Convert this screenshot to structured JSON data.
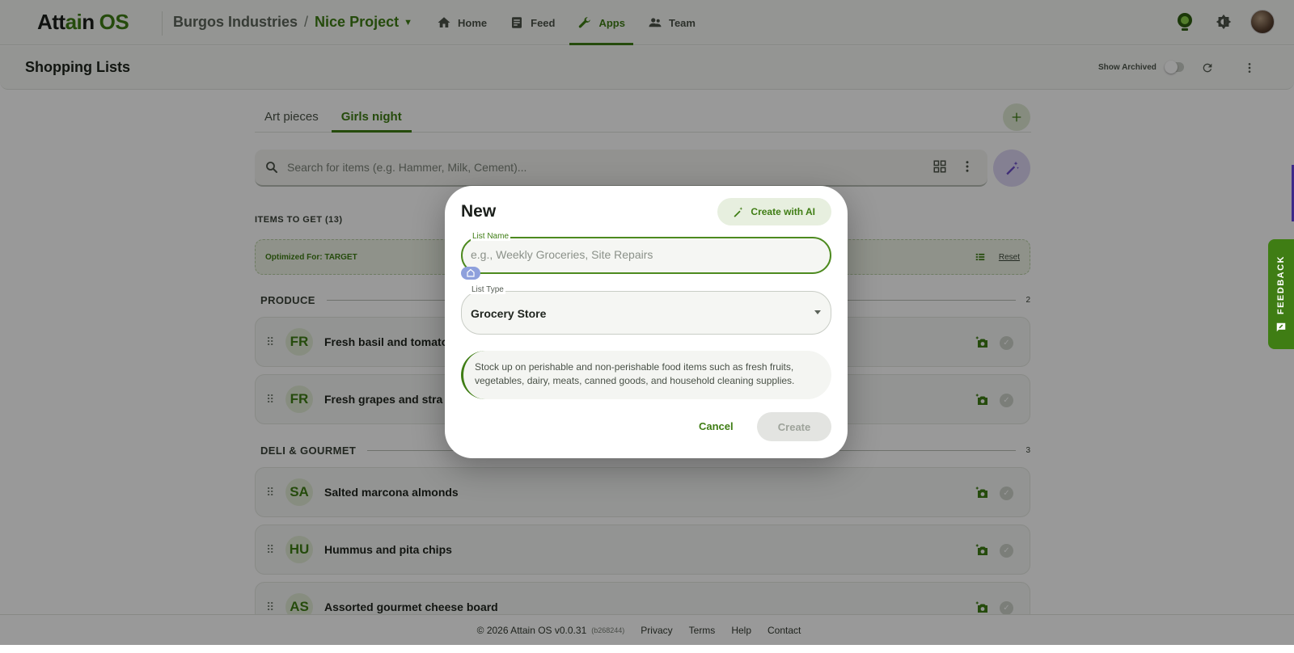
{
  "app": {
    "logo_part1": "Att",
    "logo_part2": "ai",
    "logo_part3": "n",
    "logo_os": "OS",
    "org_name": "Burgos Industries",
    "separator": "/",
    "project_name": "Nice Project",
    "nav": [
      {
        "label": "Home",
        "icon": "home-icon"
      },
      {
        "label": "Feed",
        "icon": "feed-icon"
      },
      {
        "label": "Apps",
        "icon": "wrench-icon",
        "active": true
      },
      {
        "label": "Team",
        "icon": "team-icon"
      }
    ]
  },
  "subheader": {
    "title": "Shopping Lists",
    "show_archived_label": "Show Archived",
    "show_archived_on": false
  },
  "tabs": [
    {
      "label": "Art pieces"
    },
    {
      "label": "Girls night",
      "active": true
    }
  ],
  "search": {
    "placeholder": "Search for items (e.g. Hammer, Milk, Cement)..."
  },
  "list": {
    "items_to_get_label": "ITEMS TO GET (13)",
    "optimized_label": "Optimized For: TARGET",
    "reset_label": "Reset",
    "categories": [
      {
        "name": "PRODUCE",
        "count": "2",
        "items": [
          {
            "initials": "FR",
            "name": "Fresh basil and tomato"
          },
          {
            "initials": "FR",
            "name": "Fresh grapes and stra"
          }
        ]
      },
      {
        "name": "DELI & GOURMET",
        "count": "3",
        "items": [
          {
            "initials": "SA",
            "name": "Salted marcona almonds"
          },
          {
            "initials": "HU",
            "name": "Hummus and pita chips"
          },
          {
            "initials": "AS",
            "name": "Assorted gourmet cheese board"
          }
        ]
      }
    ]
  },
  "footer": {
    "copyright": "© 2026 Attain OS v0.0.31",
    "build": "(b268244)",
    "links": [
      "Privacy",
      "Terms",
      "Help",
      "Contact"
    ]
  },
  "feedback_label": "FEEDBACK",
  "dialog": {
    "title": "New",
    "create_ai_label": "Create with AI",
    "name_label": "List Name",
    "name_placeholder": "e.g., Weekly Groceries, Site Repairs",
    "name_value": "",
    "type_label": "List Type",
    "type_value": "Grocery Store",
    "description": "Stock up on perishable and non-perishable food items such as fresh fruits, vegetables, dairy, meats, canned goods, and household cleaning supplies.",
    "cancel_label": "Cancel",
    "create_label": "Create"
  },
  "colors": {
    "brand_green": "#3f7d14",
    "ai_purple": "#6a4bc7",
    "overlay": "rgba(0,0,0,0.40)"
  }
}
